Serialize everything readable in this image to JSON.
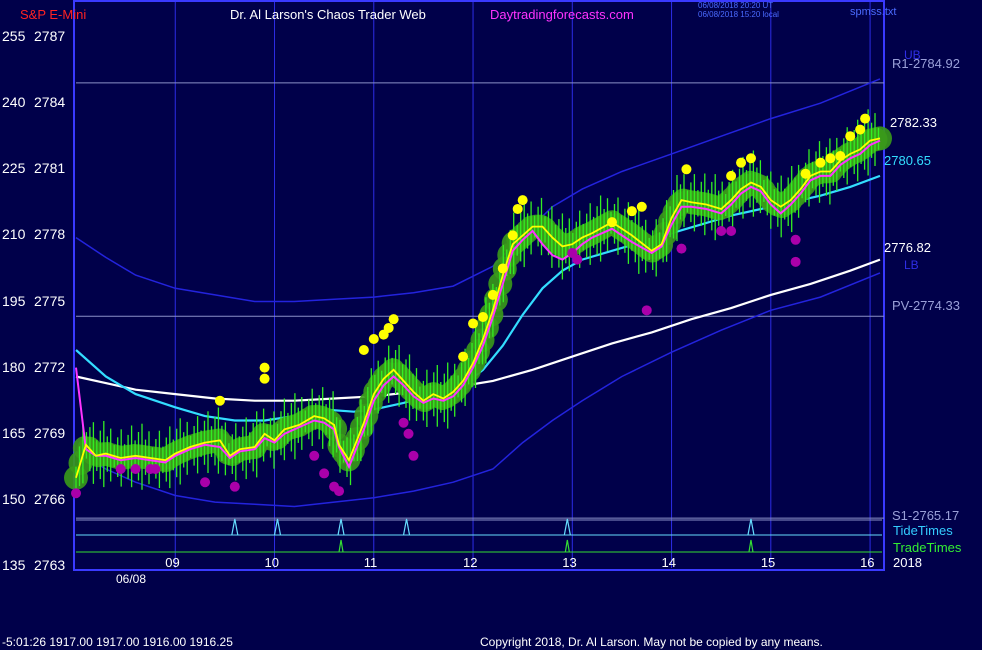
{
  "header": {
    "symbol": "S&P E-Mini",
    "app_title": "Dr. Al Larson's Chaos Trader Web",
    "website": "Daytradingforecasts.com",
    "timestamp_ut": "06/08/2018 20:20 UT",
    "timestamp_local": "06/08/2018 15:20 local",
    "source_file": "spmss.txt"
  },
  "footer": {
    "quote_readout": "-5:01:26  1917.00 1917.00 1916.00 1916.25",
    "copyright": "Copyright 2018, Dr. Al Larson. May not be copied by any means."
  },
  "colors": {
    "background": "#00004a",
    "plot_border": "#3a3aff",
    "gridline": "#2c2ce6",
    "price_line": "#ffff00",
    "fast_avg": "#ff33ff",
    "mid_avg": "#33ddff",
    "slow_avg": "#ffffff",
    "band": "#2323dd",
    "glow": "#3a9a1a",
    "bars": "#33ee22",
    "high_dots": "#ffff00",
    "low_dots": "#aa00aa",
    "tide_line": "#66ddff",
    "trade_line": "#33dd33"
  },
  "chart_data": {
    "type": "line",
    "x_unit": "hour of day (06/08/2018)",
    "xlim": [
      8.0,
      16.1
    ],
    "ylim": [
      2763,
      2788
    ],
    "x_ticks": [
      {
        "x": 9,
        "label": "09"
      },
      {
        "x": 10,
        "label": "10"
      },
      {
        "x": 11,
        "label": "11"
      },
      {
        "x": 12,
        "label": "12"
      },
      {
        "x": 13,
        "label": "13"
      },
      {
        "x": 14,
        "label": "14"
      },
      {
        "x": 15,
        "label": "15"
      },
      {
        "x": 16,
        "label": "16"
      }
    ],
    "date_label": "06/08",
    "year_label": "2018",
    "y_ticks": [
      {
        "price": 2787,
        "osc": "255"
      },
      {
        "price": 2784,
        "osc": "240"
      },
      {
        "price": 2781,
        "osc": "225"
      },
      {
        "price": 2778,
        "osc": "210"
      },
      {
        "price": 2775,
        "osc": "195"
      },
      {
        "price": 2772,
        "osc": "180"
      },
      {
        "price": 2769,
        "osc": "165"
      },
      {
        "price": 2766,
        "osc": "150"
      },
      {
        "price": 2763,
        "osc": "135"
      }
    ],
    "levels": [
      {
        "name": "R1",
        "label": "R1-2784.92",
        "value": 2784.92
      },
      {
        "name": "PV",
        "label": "PV-2774.33",
        "value": 2774.33
      },
      {
        "name": "S1",
        "label": "S1-2765.17",
        "value": 2765.17
      }
    ],
    "band_labels": {
      "upper": "UB",
      "lower": "LB"
    },
    "value_labels": [
      {
        "series": "price",
        "label": "2782.33",
        "value": 2782.33
      },
      {
        "series": "mid_avg",
        "label": "2780.65",
        "value": 2780.65
      },
      {
        "series": "slow_avg",
        "label": "2776.82",
        "value": 2776.82
      }
    ],
    "timing_rows": {
      "tide": "TideTimes",
      "trade": "TradeTimes"
    },
    "tide_times": [
      9.6,
      10.03,
      10.67,
      11.33,
      12.95,
      14.8
    ],
    "trade_times": [
      10.67,
      12.95,
      14.8
    ],
    "series": [
      {
        "key": "price",
        "x": [
          8.0,
          8.1,
          8.2,
          8.3,
          8.45,
          8.6,
          8.75,
          8.9,
          9.0,
          9.15,
          9.3,
          9.45,
          9.55,
          9.65,
          9.8,
          9.9,
          10.0,
          10.1,
          10.25,
          10.4,
          10.5,
          10.6,
          10.65,
          10.75,
          10.9,
          11.0,
          11.1,
          11.2,
          11.3,
          11.4,
          11.5,
          11.6,
          11.7,
          11.8,
          11.9,
          12.0,
          12.1,
          12.2,
          12.3,
          12.4,
          12.5,
          12.6,
          12.7,
          12.8,
          12.9,
          13.0,
          13.1,
          13.2,
          13.4,
          13.6,
          13.8,
          13.9,
          14.0,
          14.1,
          14.2,
          14.35,
          14.5,
          14.6,
          14.7,
          14.8,
          14.9,
          15.0,
          15.1,
          15.2,
          15.3,
          15.4,
          15.5,
          15.6,
          15.7,
          15.8,
          15.9,
          16.0,
          16.1
        ],
        "y": [
          2767.0,
          2768.5,
          2768.0,
          2768.1,
          2767.9,
          2768.0,
          2767.9,
          2767.8,
          2768.1,
          2768.4,
          2768.6,
          2768.7,
          2768.0,
          2768.3,
          2768.4,
          2769.0,
          2768.7,
          2769.2,
          2769.4,
          2769.8,
          2769.7,
          2769.4,
          2768.5,
          2767.8,
          2769.5,
          2770.8,
          2771.5,
          2771.9,
          2771.4,
          2770.9,
          2770.5,
          2770.8,
          2770.6,
          2770.9,
          2771.4,
          2772.2,
          2773.3,
          2774.6,
          2776.2,
          2777.6,
          2778.0,
          2778.4,
          2778.4,
          2777.9,
          2777.5,
          2777.6,
          2777.9,
          2778.1,
          2778.6,
          2778.0,
          2777.3,
          2777.6,
          2778.8,
          2779.6,
          2779.5,
          2779.4,
          2779.2,
          2779.6,
          2780.1,
          2780.4,
          2780.2,
          2779.6,
          2779.3,
          2779.6,
          2780.1,
          2780.7,
          2780.9,
          2780.9,
          2781.4,
          2781.7,
          2781.9,
          2782.3,
          2782.4
        ]
      },
      {
        "key": "fast_avg",
        "x": [
          8.0,
          8.1,
          8.2,
          8.3,
          8.45,
          8.6,
          8.75,
          8.9,
          9.0,
          9.15,
          9.3,
          9.45,
          9.55,
          9.65,
          9.8,
          9.9,
          10.0,
          10.1,
          10.25,
          10.4,
          10.5,
          10.6,
          10.65,
          10.75,
          10.9,
          11.0,
          11.1,
          11.2,
          11.3,
          11.4,
          11.5,
          11.6,
          11.7,
          11.8,
          11.9,
          12.0,
          12.1,
          12.2,
          12.3,
          12.4,
          12.5,
          12.6,
          12.7,
          12.8,
          12.9,
          13.0,
          13.1,
          13.2,
          13.4,
          13.6,
          13.8,
          13.9,
          14.0,
          14.1,
          14.2,
          14.35,
          14.5,
          14.6,
          14.7,
          14.8,
          14.9,
          15.0,
          15.1,
          15.2,
          15.3,
          15.4,
          15.5,
          15.6,
          15.7,
          15.8,
          15.9,
          16.0,
          16.1
        ],
        "y": [
          2772.0,
          2768.3,
          2768.0,
          2768.0,
          2767.8,
          2767.9,
          2767.8,
          2767.7,
          2768.0,
          2768.3,
          2768.5,
          2768.4,
          2767.9,
          2768.2,
          2768.3,
          2768.8,
          2768.6,
          2769.0,
          2769.3,
          2769.6,
          2769.5,
          2769.2,
          2768.4,
          2767.5,
          2769.2,
          2770.5,
          2771.2,
          2771.6,
          2771.2,
          2770.7,
          2770.4,
          2770.6,
          2770.5,
          2770.7,
          2771.2,
          2772.0,
          2773.0,
          2774.3,
          2775.8,
          2777.3,
          2777.8,
          2778.2,
          2777.6,
          2777.1,
          2776.9,
          2777.2,
          2777.6,
          2777.9,
          2778.3,
          2777.7,
          2777.2,
          2777.5,
          2778.5,
          2779.3,
          2779.3,
          2779.2,
          2779.0,
          2779.4,
          2779.9,
          2780.2,
          2780.0,
          2779.4,
          2779.0,
          2779.4,
          2779.9,
          2780.5,
          2780.7,
          2780.7,
          2781.2,
          2781.5,
          2781.7,
          2782.1,
          2782.3
        ]
      },
      {
        "key": "mid_avg",
        "x": [
          8.0,
          8.3,
          8.6,
          9.0,
          9.3,
          9.6,
          9.9,
          10.2,
          10.5,
          10.8,
          11.0,
          11.3,
          11.6,
          11.9,
          12.1,
          12.3,
          12.5,
          12.7,
          12.9,
          13.1,
          13.4,
          13.7,
          14.0,
          14.3,
          14.6,
          14.9,
          15.2,
          15.5,
          15.8,
          16.1
        ],
        "y": [
          2772.8,
          2771.6,
          2770.8,
          2770.2,
          2769.8,
          2769.6,
          2769.6,
          2769.8,
          2770.1,
          2770.0,
          2770.1,
          2770.4,
          2770.8,
          2771.2,
          2771.9,
          2773.0,
          2774.4,
          2775.6,
          2776.4,
          2776.9,
          2777.3,
          2777.7,
          2778.1,
          2778.5,
          2778.9,
          2779.2,
          2779.5,
          2779.8,
          2780.2,
          2780.7
        ]
      },
      {
        "key": "slow_avg",
        "x": [
          8.0,
          8.3,
          8.6,
          9.0,
          9.4,
          9.8,
          10.2,
          10.6,
          11.0,
          11.4,
          11.8,
          12.2,
          12.6,
          13.0,
          13.4,
          13.8,
          14.2,
          14.6,
          15.0,
          15.4,
          15.8,
          16.1
        ],
        "y": [
          2771.6,
          2771.3,
          2771.0,
          2770.8,
          2770.6,
          2770.5,
          2770.5,
          2770.6,
          2770.7,
          2770.9,
          2771.1,
          2771.4,
          2771.9,
          2772.5,
          2773.1,
          2773.6,
          2774.2,
          2774.7,
          2775.3,
          2775.8,
          2776.4,
          2776.9
        ]
      },
      {
        "key": "upper_band",
        "x": [
          8.0,
          8.3,
          8.6,
          9.0,
          9.4,
          9.8,
          10.2,
          10.6,
          11.0,
          11.4,
          11.8,
          12.2,
          12.5,
          12.8,
          13.1,
          13.5,
          14.0,
          14.5,
          15.0,
          15.5,
          16.1
        ],
        "y": [
          2777.9,
          2777.0,
          2776.2,
          2775.6,
          2775.3,
          2775.0,
          2775.0,
          2775.1,
          2775.2,
          2775.4,
          2775.7,
          2776.6,
          2778.0,
          2779.3,
          2780.1,
          2780.9,
          2781.7,
          2782.5,
          2783.3,
          2784.0,
          2785.1
        ]
      },
      {
        "key": "lower_band",
        "x": [
          8.0,
          8.3,
          8.6,
          9.0,
          9.4,
          9.8,
          10.2,
          10.6,
          11.0,
          11.4,
          11.8,
          12.2,
          12.5,
          12.8,
          13.1,
          13.5,
          14.0,
          14.5,
          15.0,
          15.5,
          16.1
        ],
        "y": [
          2768.2,
          2767.4,
          2766.8,
          2766.2,
          2765.9,
          2765.8,
          2765.7,
          2765.9,
          2766.1,
          2766.4,
          2766.8,
          2767.4,
          2768.6,
          2769.6,
          2770.5,
          2771.6,
          2772.7,
          2773.7,
          2774.6,
          2775.2,
          2776.3
        ]
      }
    ],
    "high_dots": [
      {
        "x": 9.45,
        "y": 2770.5
      },
      {
        "x": 9.9,
        "y": 2771.5
      },
      {
        "x": 9.9,
        "y": 2772.0
      },
      {
        "x": 10.9,
        "y": 2772.8
      },
      {
        "x": 11.0,
        "y": 2773.3
      },
      {
        "x": 11.1,
        "y": 2773.5
      },
      {
        "x": 11.15,
        "y": 2773.8
      },
      {
        "x": 11.2,
        "y": 2774.2
      },
      {
        "x": 11.9,
        "y": 2772.5
      },
      {
        "x": 12.0,
        "y": 2774.0
      },
      {
        "x": 12.1,
        "y": 2774.3
      },
      {
        "x": 12.2,
        "y": 2775.3
      },
      {
        "x": 12.3,
        "y": 2776.5
      },
      {
        "x": 12.4,
        "y": 2778.0
      },
      {
        "x": 12.45,
        "y": 2779.2
      },
      {
        "x": 12.5,
        "y": 2779.6
      },
      {
        "x": 13.4,
        "y": 2778.6
      },
      {
        "x": 13.6,
        "y": 2779.1
      },
      {
        "x": 13.7,
        "y": 2779.3
      },
      {
        "x": 14.15,
        "y": 2781.0
      },
      {
        "x": 14.6,
        "y": 2780.7
      },
      {
        "x": 14.7,
        "y": 2781.3
      },
      {
        "x": 14.8,
        "y": 2781.5
      },
      {
        "x": 15.35,
        "y": 2780.8
      },
      {
        "x": 15.5,
        "y": 2781.3
      },
      {
        "x": 15.6,
        "y": 2781.5
      },
      {
        "x": 15.7,
        "y": 2781.6
      },
      {
        "x": 15.8,
        "y": 2782.5
      },
      {
        "x": 15.9,
        "y": 2782.8
      },
      {
        "x": 15.95,
        "y": 2783.3
      }
    ],
    "low_dots": [
      {
        "x": 8.0,
        "y": 2766.3
      },
      {
        "x": 8.45,
        "y": 2767.4
      },
      {
        "x": 8.6,
        "y": 2767.4
      },
      {
        "x": 8.75,
        "y": 2767.4
      },
      {
        "x": 8.8,
        "y": 2767.4
      },
      {
        "x": 9.3,
        "y": 2766.8
      },
      {
        "x": 9.6,
        "y": 2766.6
      },
      {
        "x": 10.4,
        "y": 2768.0
      },
      {
        "x": 10.5,
        "y": 2767.2
      },
      {
        "x": 10.6,
        "y": 2766.6
      },
      {
        "x": 10.65,
        "y": 2766.4
      },
      {
        "x": 11.3,
        "y": 2769.5
      },
      {
        "x": 11.35,
        "y": 2769.0
      },
      {
        "x": 11.4,
        "y": 2768.0
      },
      {
        "x": 13.0,
        "y": 2777.2
      },
      {
        "x": 13.05,
        "y": 2776.9
      },
      {
        "x": 13.75,
        "y": 2774.6
      },
      {
        "x": 14.1,
        "y": 2777.4
      },
      {
        "x": 14.5,
        "y": 2778.2
      },
      {
        "x": 14.6,
        "y": 2778.2
      },
      {
        "x": 15.25,
        "y": 2777.8
      },
      {
        "x": 15.25,
        "y": 2776.8
      }
    ]
  }
}
